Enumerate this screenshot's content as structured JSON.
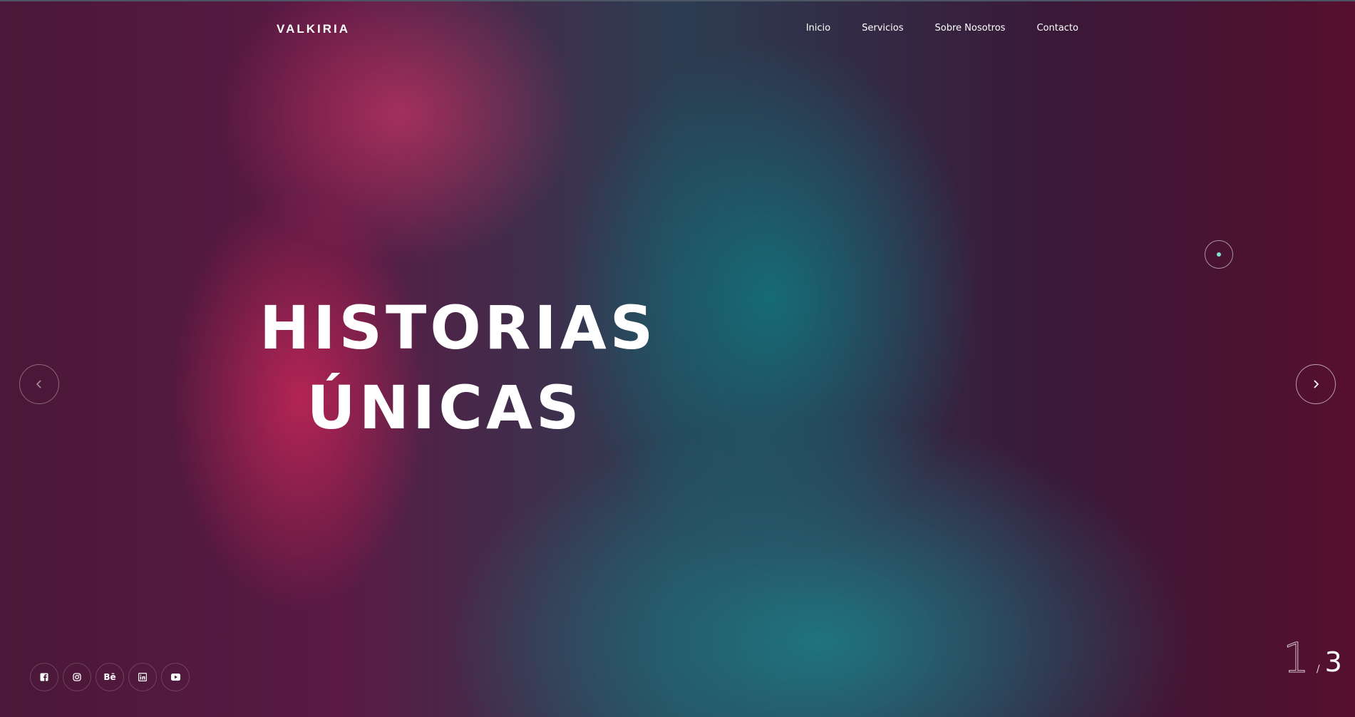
{
  "header": {
    "logo": "VALKIRIA",
    "nav": [
      "Inicio",
      "Servicios",
      "Sobre Nosotros",
      "Contacto"
    ]
  },
  "hero": {
    "title_line1": "HISTORIAS",
    "title_line2": "ÚNICAS"
  },
  "slider": {
    "current": "1",
    "separator": "/",
    "total": "3"
  },
  "social": {
    "icons": [
      "facebook-icon",
      "instagram-icon",
      "behance-icon",
      "linkedin-icon",
      "youtube-icon"
    ],
    "behance_label": "Bē"
  },
  "colors": {
    "accent_dot": "#7fe0d4",
    "text": "#ffffff"
  }
}
